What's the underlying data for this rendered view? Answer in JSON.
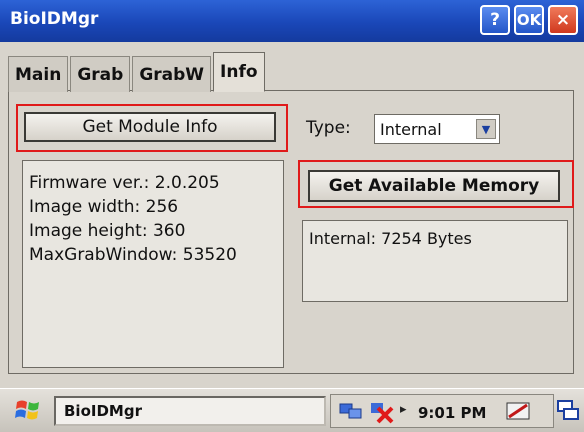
{
  "window": {
    "title": "BioIDMgr",
    "help_label": "?",
    "ok_label": "OK",
    "close_label": "×"
  },
  "tabs": [
    {
      "label": "Main",
      "active": false
    },
    {
      "label": "Grab",
      "active": false
    },
    {
      "label": "GrabW",
      "active": false
    },
    {
      "label": "Info",
      "active": true
    }
  ],
  "info": {
    "get_module_info_label": "Get Module Info",
    "type_label": "Type:",
    "type_value": "Internal",
    "get_memory_label": "Get Available Memory",
    "module_lines": [
      "Firmware ver.: 2.0.205",
      "Image width: 256",
      "Image height: 360",
      "MaxGrabWindow: 53520"
    ],
    "memory_text": "Internal: 7254 Bytes"
  },
  "taskbar": {
    "app_label": "BioIDMgr",
    "time": "9:01 PM"
  },
  "colors": {
    "titlebar": "#1f4fc4",
    "highlight": "#e01a1a"
  }
}
